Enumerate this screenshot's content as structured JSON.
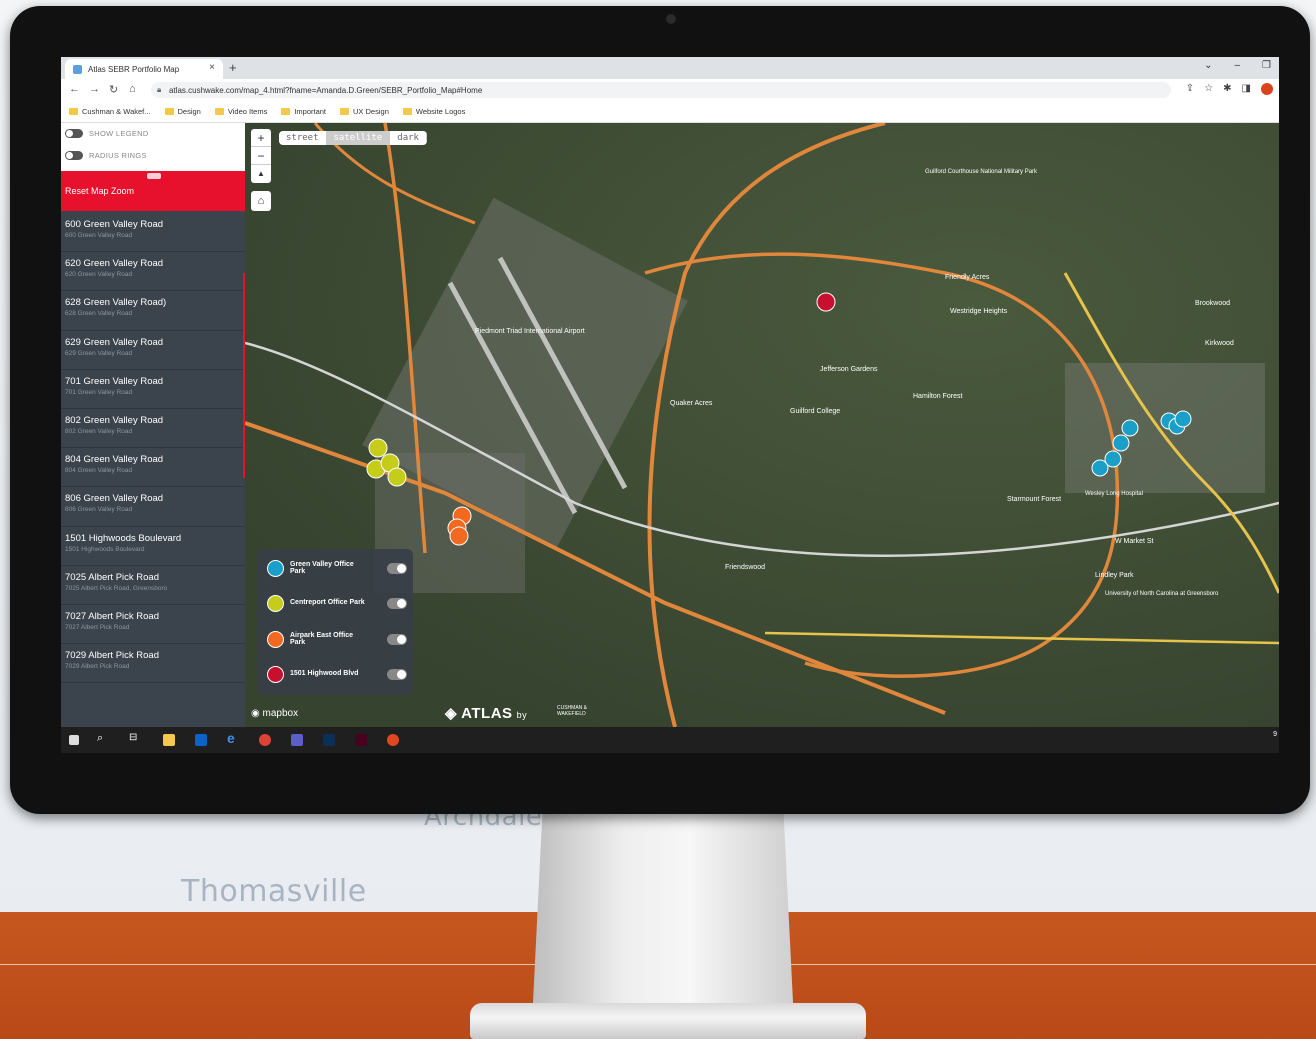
{
  "background": {
    "town_label": "Thomasville",
    "area_label": "Archdale",
    "band_color": "#c45520"
  },
  "browser": {
    "tab_title": "Atlas SEBR Portfolio Map",
    "url": "atlas.cushwake.com/map_4.html?fname=Amanda.D.Green/SEBR_Portfolio_Map#Home",
    "bookmarks": [
      "Cushman & Wakef...",
      "Design",
      "Video Items",
      "Important",
      "UX Design",
      "Website Logos"
    ]
  },
  "panel": {
    "show_legend_label": "SHOW LEGEND",
    "radius_rings_label": "RADIUS RINGS",
    "reset_label": "Reset Map Zoom",
    "accent_color": "#e8112d",
    "properties": [
      {
        "title": "600 Green Valley Road",
        "subtitle": "600 Green Valley Road"
      },
      {
        "title": "620 Green Valley Road",
        "subtitle": "620 Green Valley Road"
      },
      {
        "title": "628 Green Valley Road)",
        "subtitle": "628 Green Valley Road"
      },
      {
        "title": "629 Green Valley Road",
        "subtitle": "629 Green Valley Road"
      },
      {
        "title": "701 Green Valley Road",
        "subtitle": "701 Green Valley Road"
      },
      {
        "title": "802 Green Valley Road",
        "subtitle": "802 Green Valley Road"
      },
      {
        "title": "804 Green Valley Road",
        "subtitle": "804 Green Valley Road"
      },
      {
        "title": "806 Green Valley Road",
        "subtitle": "806 Green Valley Road"
      },
      {
        "title": "1501 Highwoods Boulevard",
        "subtitle": "1501 Highwoods Boulevard"
      },
      {
        "title": "7025 Albert Pick Road",
        "subtitle": "7025 Albert Pick Road, Greensboro"
      },
      {
        "title": "7027 Albert Pick Road",
        "subtitle": "7027 Albert Pick Road"
      },
      {
        "title": "7029 Albert Pick Road",
        "subtitle": "7029 Albert Pick Road"
      }
    ]
  },
  "map": {
    "zoom_in": "+",
    "zoom_out": "−",
    "compass": "▲",
    "styles": [
      "street",
      "satellite",
      "dark"
    ],
    "active_style": "satellite",
    "legend": [
      {
        "label": "Green Valley Office Park",
        "color": "#1aa0c8"
      },
      {
        "label": "Centreport Office Park",
        "color": "#c5cc1a"
      },
      {
        "label": "Airpark East Office Park",
        "color": "#f26a21"
      },
      {
        "label": "1501 Highwood Blvd",
        "color": "#c8102e"
      }
    ],
    "place_labels": [
      "Piedmont Triad International Airport",
      "Quaker Acres",
      "Guilford College",
      "Jefferson Gardens",
      "Hamilton Forest",
      "Westridge Heights",
      "Friendly Acres",
      "Starmount Forest",
      "Friendswood",
      "Lindley Park",
      "Brookwood",
      "Kirkwood",
      "Guilford Courthouse National Military Park",
      "University of North Carolina at Greensboro",
      "W Market St",
      "Wesley Long Hospital"
    ],
    "attribution": "mapbox",
    "brand": "ATLAS",
    "brand_by": "by",
    "brand_partner": "CUSHMAN & WAKEFIELD"
  },
  "taskbar": {
    "clock": "9"
  }
}
